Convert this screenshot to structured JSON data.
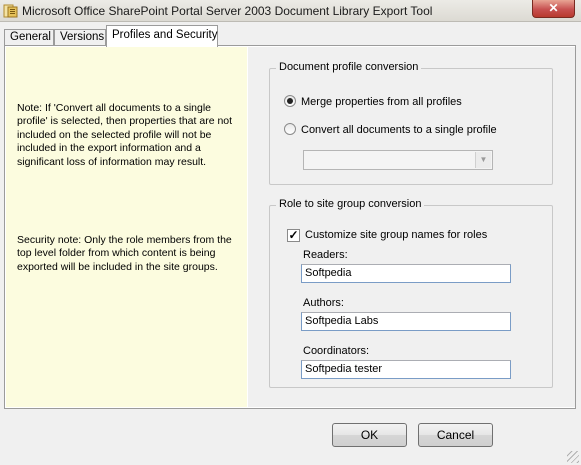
{
  "window": {
    "title": "Microsoft Office SharePoint Portal Server 2003 Document Library Export Tool",
    "close_glyph": "✕"
  },
  "tabs": [
    {
      "label": "General"
    },
    {
      "label": "Versions"
    },
    {
      "label": "Profiles and Security",
      "active": true
    }
  ],
  "notes": {
    "profile_note": "Note: If 'Convert all documents to a single profile' is selected, then properties that are not included on the selected profile will not be included in the export information and a significant loss of information may result.",
    "security_note": "Security note: Only the role members from the top level folder from which content is being exported will be included in the site groups."
  },
  "document_profile_conversion": {
    "legend": "Document profile conversion",
    "options": [
      {
        "label": "Merge properties from all profiles",
        "selected": true
      },
      {
        "label": "Convert all documents to a single profile",
        "selected": false
      }
    ],
    "profile_select": {
      "value": "",
      "enabled": false
    }
  },
  "role_conversion": {
    "legend": "Role to site group conversion",
    "customize_label": "Customize site group names for roles",
    "customize_checked": true,
    "fields": [
      {
        "label": "Readers:",
        "value": "Softpedia"
      },
      {
        "label": "Authors:",
        "value": "Softpedia Labs"
      },
      {
        "label": "Coordinators:",
        "value": "Softpedia tester"
      }
    ]
  },
  "buttons": {
    "ok": "OK",
    "cancel": "Cancel"
  },
  "colors": {
    "notes_background": "#fcfcdf",
    "close_button": "#c75050"
  },
  "icons": {
    "app": "app-icon",
    "close": "close-icon",
    "dropdown": "chevron-down-icon",
    "check": "checkmark-icon",
    "grip": "resize-grip-icon"
  }
}
